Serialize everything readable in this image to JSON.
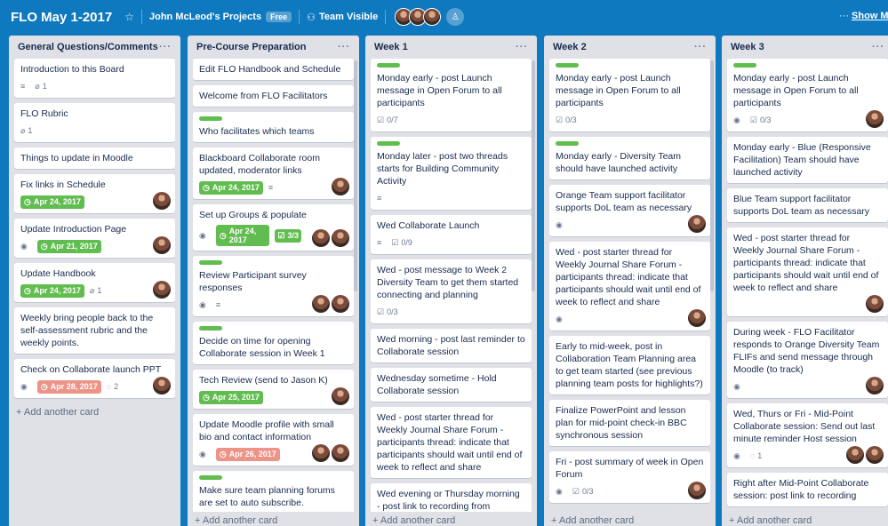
{
  "header": {
    "board_title": "FLO May 1-2017",
    "star_icon": "star-icon",
    "team_name": "John McLeod's Projects",
    "plan_badge": "Free",
    "visibility": "Team Visible",
    "show_menu": "Show Menu"
  },
  "lists": [
    {
      "title": "General Questions/Comments",
      "add_card": "+ Add another card",
      "cards": [
        {
          "title": "Introduction to this Board",
          "description": true,
          "attachments": "1"
        },
        {
          "title": "FLO Rubric",
          "attachments": "1"
        },
        {
          "title": "Things to update in Moodle"
        },
        {
          "title": "Fix links in Schedule",
          "due": "Apr 24, 2017",
          "due_color": "green",
          "members": 1
        },
        {
          "title": "Update Introduction Page",
          "watch": true,
          "due": "Apr 21, 2017",
          "due_color": "green",
          "members": 1
        },
        {
          "title": "Update Handbook",
          "due": "Apr 24, 2017",
          "due_color": "green",
          "attachments": "1",
          "members": 1
        },
        {
          "title": "Weekly bring people back to the self-assessment rubric and the weekly points."
        },
        {
          "title": "Check on Collaborate launch PPT",
          "watch": true,
          "due": "Apr 28, 2017",
          "due_color": "red",
          "comments": "2",
          "members": 1
        }
      ]
    },
    {
      "title": "Pre-Course Preparation",
      "add_card": "+ Add another card",
      "cards": [
        {
          "title": "Edit FLO Handbook and Schedule"
        },
        {
          "title": "Welcome from FLO Facilitators"
        },
        {
          "title": "Who facilitates which teams",
          "label": true
        },
        {
          "title": "Blackboard Collaborate room updated, moderator links",
          "due": "Apr 24, 2017",
          "due_color": "green",
          "description": true,
          "members": 1
        },
        {
          "title": "Set up Groups & populate",
          "watch": true,
          "due": "Apr 24, 2017",
          "due_color": "green",
          "checklist_done": "3/3",
          "members": 2
        },
        {
          "title": "Review Participant survey responses",
          "label": true,
          "watch": true,
          "description": true,
          "members": 2
        },
        {
          "title": "Decide on time for opening Collaborate session in Week 1",
          "label": true
        },
        {
          "title": "Tech Review (send to Jason K)",
          "due": "Apr 25, 2017",
          "due_color": "green",
          "members": 1
        },
        {
          "title": "Update Moodle profile with small bio and contact information",
          "watch": true,
          "due": "Apr 26, 2017",
          "due_color": "red",
          "members": 2
        },
        {
          "title": "Make sure team planning forums are set to auto subscribe.",
          "label": true
        }
      ]
    },
    {
      "title": "Week 1",
      "add_card": "+ Add another card",
      "cards": [
        {
          "title": "Monday early - post Launch message in Open Forum to all participants",
          "label": true,
          "checklist": "0/7"
        },
        {
          "title": "Monday later - post two threads starts for Building Community Activity",
          "label": true,
          "description": true
        },
        {
          "title": "Wed Collaborate Launch",
          "description": true,
          "checklist": "0/9"
        },
        {
          "title": "Wed - post message to Week 2 Diversity Team to get them started connecting and planning",
          "checklist": "0/3"
        },
        {
          "title": "Wed morning - post last reminder to Collaborate session"
        },
        {
          "title": "Wednesday sometime - Hold Collaborate session"
        },
        {
          "title": "Wed - post starter thread for Weekly Journal Share Forum - participants thread: indicate that participants should wait until end of week to reflect and share"
        },
        {
          "title": "Wed evening or Thursday morning - post link to recording from"
        }
      ]
    },
    {
      "title": "Week 2",
      "add_card": "+ Add another card",
      "cards": [
        {
          "title": "Monday early - post Launch message in Open Forum to all participants",
          "label": true,
          "checklist": "0/3"
        },
        {
          "title": "Monday early - Diversity Team should have launched activity",
          "label": true
        },
        {
          "title": "Orange Team support facilitator supports DoL team as necessary",
          "watch": true,
          "members": 1
        },
        {
          "title": "Wed - post starter thread for Weekly Journal Share Forum - participants thread: indicate that participants should wait until end of week to reflect and share",
          "watch": true,
          "members": 1
        },
        {
          "title": "Early to mid-week, post in Collaboration Team Planning area to get team started (see previous planning team posts for highlights?)"
        },
        {
          "title": "Finalize PowerPoint and lesson plan for mid-point check-in BBC synchronous session"
        },
        {
          "title": "Fri - post summary of week in Open Forum",
          "watch": true,
          "checklist": "0/3",
          "members": 1
        }
      ]
    },
    {
      "title": "Week 3",
      "add_card": "+ Add another card",
      "cards": [
        {
          "title": "Monday early - post Launch message in Open Forum to all participants",
          "label": true,
          "watch": true,
          "checklist": "0/3",
          "members": 1
        },
        {
          "title": "Monday early - Blue (Responsive Facilitation) Team should have launched activity"
        },
        {
          "title": "Blue Team support facilitator supports DoL team as necessary"
        },
        {
          "title": "Wed - post starter thread for Weekly Journal Share Forum - participants thread: indicate that participants should wait until end of week to reflect and share",
          "members": 1
        },
        {
          "title": "During week - FLO Facilitator responds to Orange Diversity Team FLIFs and send message through Moodle (to track)",
          "watch": true,
          "members": 1
        },
        {
          "title": "Wed, Thurs or Fri - Mid-Point Collaborate session: Send out last minute reminder Host session",
          "watch": true,
          "comments": "1",
          "members": 2
        },
        {
          "title": "Right after Mid-Point Collaborate session: post link to recording"
        }
      ]
    }
  ],
  "colors": {
    "board_bg": "#0f79bf",
    "label_green": "#61bd4f",
    "due_red": "#ec9488"
  }
}
